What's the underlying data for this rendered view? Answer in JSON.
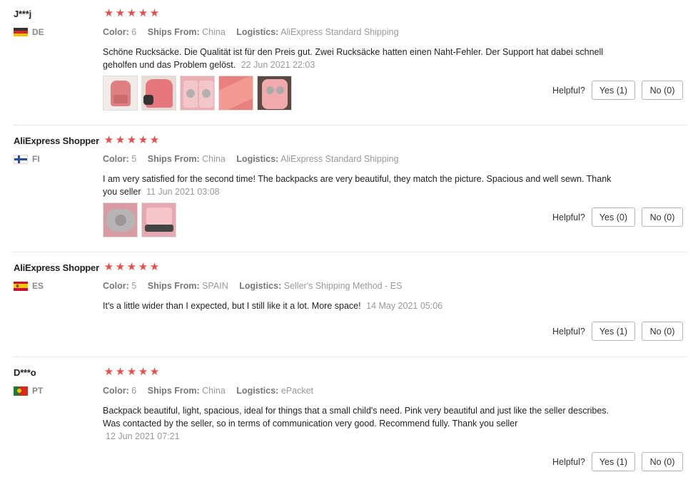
{
  "helpful_label": "Helpful?",
  "colors": {
    "star": "#e84d4d",
    "meta_value": "#999999",
    "border": "#e8e8e8"
  },
  "reviews": [
    {
      "user": "J***j",
      "country": "DE",
      "flag": "de-flag-icon",
      "stars": 5,
      "color_label": "Color:",
      "color_value": "6",
      "ships_label": "Ships From:",
      "ships_value": "China",
      "logistics_label": "Logistics:",
      "logistics_value": "AliExpress Standard Shipping",
      "text": "Schöne Rucksäcke. Die Qualität ist für den Preis gut. Zwei Rucksäcke hatten einen Naht-Fehler. Der Support hat dabei schnell geholfen und das Problem gelöst.",
      "date": "22 Jun 2021 22:03",
      "photos": 5,
      "yes": "Yes (1)",
      "no": "No (0)"
    },
    {
      "user": "AliExpress Shopper",
      "country": "FI",
      "flag": "fi-flag-icon",
      "stars": 5,
      "color_label": "Color:",
      "color_value": "5",
      "ships_label": "Ships From:",
      "ships_value": "China",
      "logistics_label": "Logistics:",
      "logistics_value": "AliExpress Standard Shipping",
      "text": "I am very satisfied for the second time! The backpacks are very beautiful, they match the picture. Spacious and well sewn. Thank you seller",
      "date": "11 Jun 2021 03:08",
      "photos": 2,
      "yes": "Yes (0)",
      "no": "No (0)"
    },
    {
      "user": "AliExpress Shopper",
      "country": "ES",
      "flag": "es-flag-icon",
      "stars": 5,
      "color_label": "Color:",
      "color_value": "5",
      "ships_label": "Ships From:",
      "ships_value": "SPAIN",
      "logistics_label": "Logistics:",
      "logistics_value": "Seller's Shipping Method - ES",
      "text": "It's a little wider than I expected, but I still like it a lot. More space!",
      "date": "14 May 2021 05:06",
      "photos": 0,
      "yes": "Yes (1)",
      "no": "No (0)"
    },
    {
      "user": "D***o",
      "country": "PT",
      "flag": "pt-flag-icon",
      "stars": 5,
      "color_label": "Color:",
      "color_value": "6",
      "ships_label": "Ships From:",
      "ships_value": "China",
      "logistics_label": "Logistics:",
      "logistics_value": "ePacket",
      "text": "Backpack beautiful, light, spacious, ideal for things that a small child's need. Pink very beautiful and just like the seller describes. Was contacted by the seller, so in terms of communication very good. Recommend fully. Thank you seller",
      "date": "12 Jun 2021 07:21",
      "photos": 0,
      "yes": "Yes (1)",
      "no": "No (0)"
    }
  ]
}
